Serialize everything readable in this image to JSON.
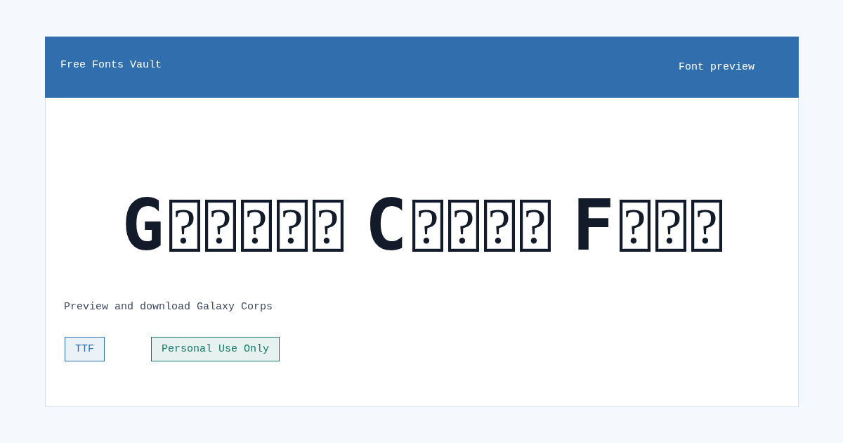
{
  "header": {
    "site_title": "Free Fonts Vault",
    "page_label": "Font preview"
  },
  "preview": {
    "words": [
      {
        "glyphs": [
          {
            "kind": "letter",
            "text": "G"
          },
          {
            "kind": "missing",
            "text": "?"
          },
          {
            "kind": "missing",
            "text": "?"
          },
          {
            "kind": "missing",
            "text": "?"
          },
          {
            "kind": "missing",
            "text": "?"
          },
          {
            "kind": "missing",
            "text": "?"
          }
        ]
      },
      {
        "glyphs": [
          {
            "kind": "letter",
            "text": "C"
          },
          {
            "kind": "missing",
            "text": "?"
          },
          {
            "kind": "missing",
            "text": "?"
          },
          {
            "kind": "missing",
            "text": "?"
          },
          {
            "kind": "missing",
            "text": "?"
          }
        ]
      },
      {
        "glyphs": [
          {
            "kind": "letter",
            "text": "F"
          },
          {
            "kind": "missing",
            "text": "?"
          },
          {
            "kind": "missing",
            "text": "?"
          },
          {
            "kind": "missing",
            "text": "?"
          }
        ]
      }
    ]
  },
  "description": "Preview and download Galaxy Corps",
  "tags": [
    {
      "label": "TTF",
      "color": "#2f6fae"
    },
    {
      "label": "Personal Use Only",
      "color": "#137a68"
    }
  ]
}
